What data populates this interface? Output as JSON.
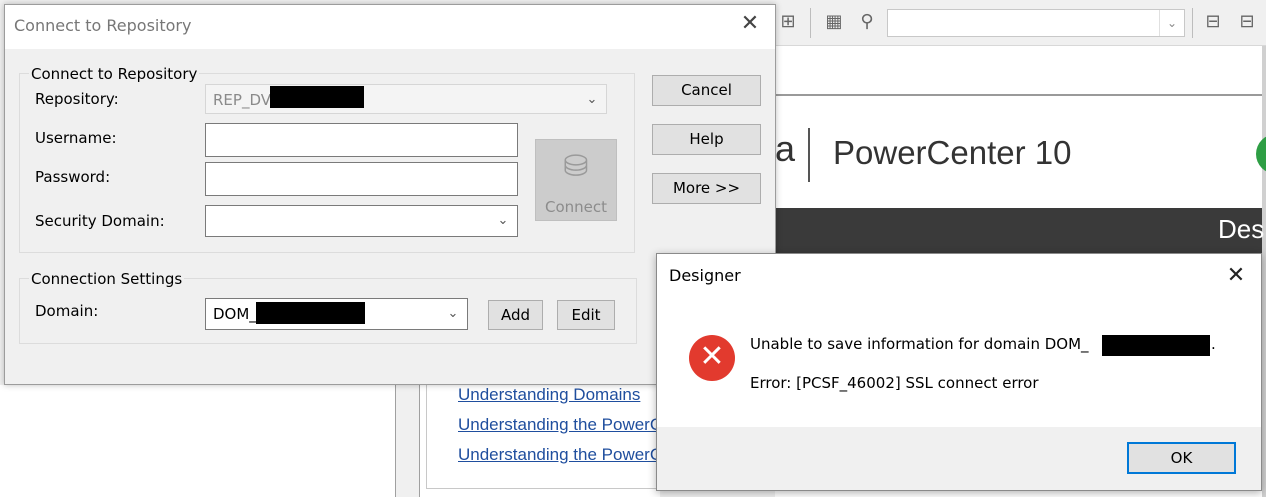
{
  "connect_dialog": {
    "title": "Connect to Repository",
    "repo_group_label": "Connect to Repository",
    "repository_label": "Repository:",
    "repository_value": "REP_DV",
    "username_label": "Username:",
    "username_value": "",
    "password_label": "Password:",
    "password_value": "",
    "security_domain_label": "Security Domain:",
    "security_domain_value": "",
    "connect_button": "Connect",
    "cancel_button": "Cancel",
    "help_button": "Help",
    "more_button": "More >>",
    "conn_group_label": "Connection Settings",
    "domain_label": "Domain:",
    "domain_value": "DOM_",
    "add_button": "Add",
    "edit_button": "Edit"
  },
  "error_dialog": {
    "title": "Designer",
    "message": "Unable to save information for domain DOM_",
    "message_end": ".",
    "error_line": "Error: [PCSF_46002] SSL connect error",
    "ok_button": "OK"
  },
  "background": {
    "banner_logo_fragment": "a",
    "banner_title": "PowerCenter 10",
    "dark_band_text": "Des",
    "links": [
      "Understanding Domains",
      "Understanding the PowerCenter",
      "Understanding the PowerCenter"
    ]
  },
  "colors": {
    "accent": "#0078d7",
    "error_icon": "#e23a2e",
    "link": "#1f4e9e"
  },
  "icons": {
    "close": "close-icon",
    "error": "error-x-icon",
    "connect": "database-connect-icon"
  }
}
